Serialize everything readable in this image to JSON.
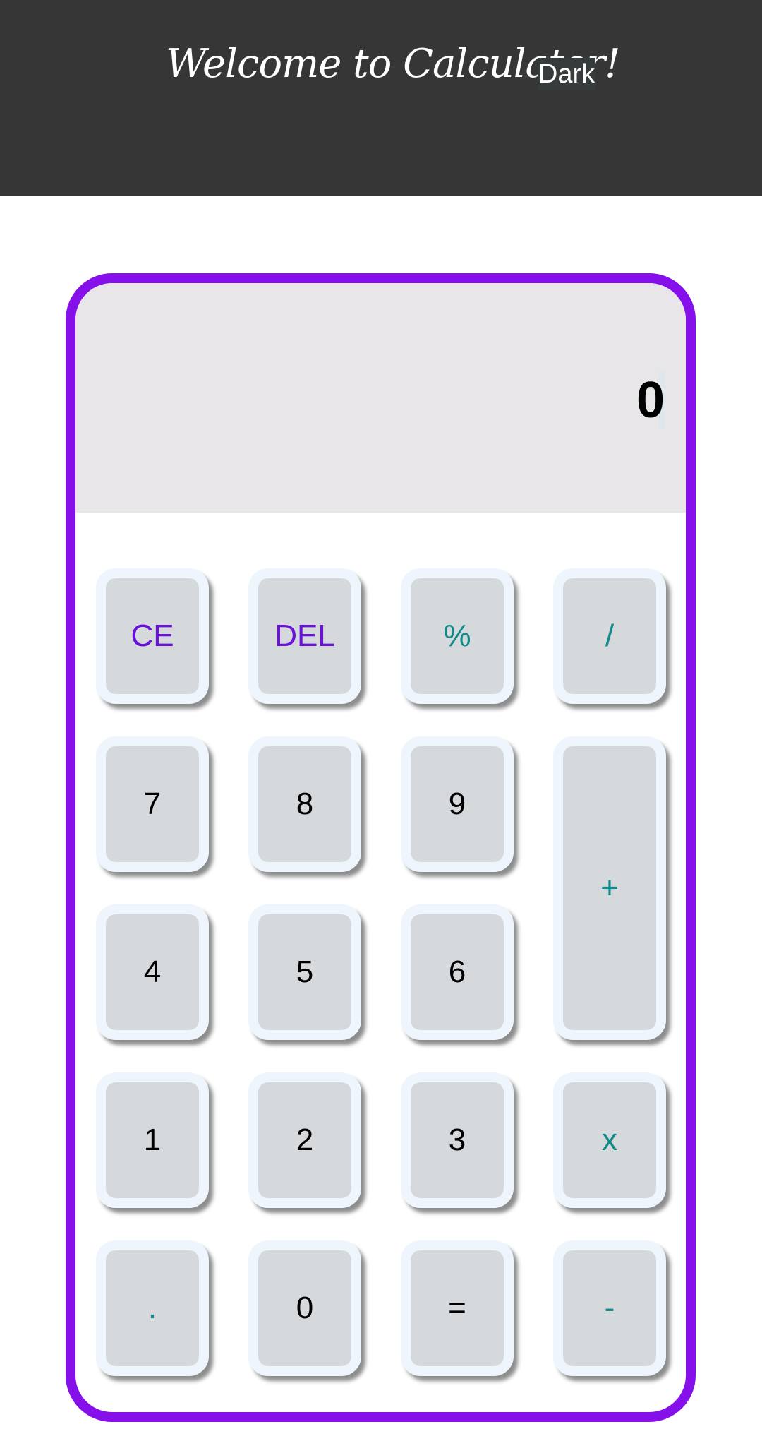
{
  "header": {
    "title": "Welcome to Calculator!",
    "theme_toggle": "Dark"
  },
  "display": {
    "value": "0"
  },
  "keys": {
    "ce": "CE",
    "del": "DEL",
    "percent": "%",
    "divide": "/",
    "seven": "7",
    "eight": "8",
    "nine": "9",
    "plus": "+",
    "four": "4",
    "five": "5",
    "six": "6",
    "one": "1",
    "two": "2",
    "three": "3",
    "multiply": "x",
    "dot": ".",
    "zero": "0",
    "equals": "=",
    "minus": "-"
  },
  "colors": {
    "header_bg": "#373637",
    "accent_border": "#8610e9",
    "function_key": "#6a12d9",
    "operator_key": "#118a8a",
    "key_bg": "#d5d9dc",
    "display_bg": "#e8e6e8"
  }
}
